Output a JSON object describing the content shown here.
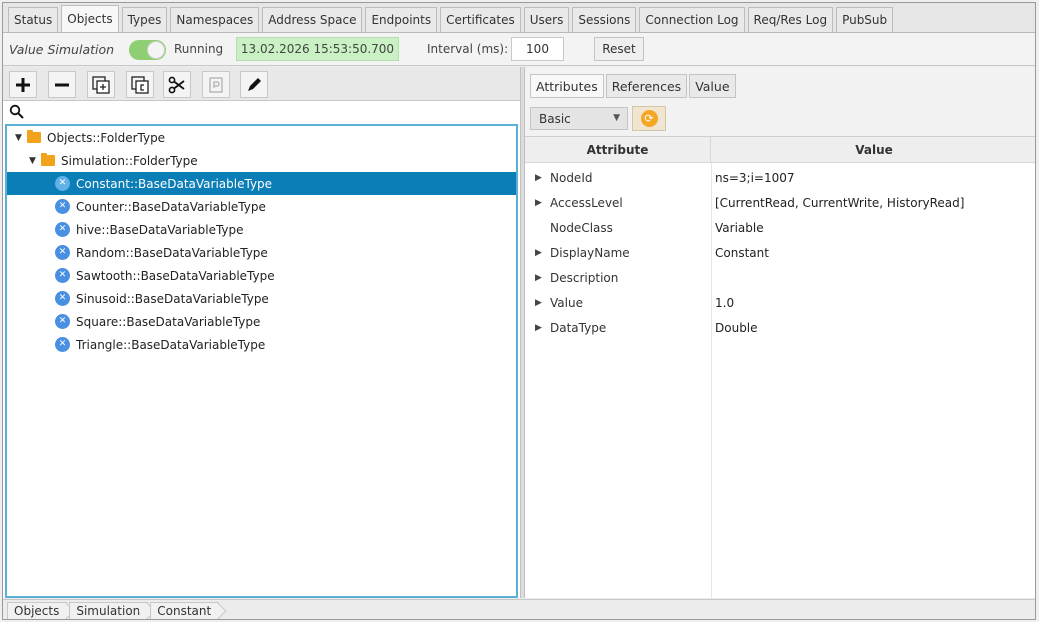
{
  "tabs": [
    "Status",
    "Objects",
    "Types",
    "Namespaces",
    "Address Space",
    "Endpoints",
    "Certificates",
    "Users",
    "Sessions",
    "Connection Log",
    "Req/Res Log",
    "PubSub"
  ],
  "active_tab": "Objects",
  "simulation": {
    "label": "Value Simulation",
    "state": "Running",
    "timestamp": "13.02.2026 15:53:50.700",
    "interval_label": "Interval (ms):",
    "interval_value": "100",
    "reset_label": "Reset",
    "toggle_on": true
  },
  "toolbar": {
    "icons": [
      "add-icon",
      "remove-icon",
      "add-child-icon",
      "copy-icon",
      "cut-icon",
      "paste-icon",
      "edit-icon"
    ]
  },
  "search": {
    "placeholder": ""
  },
  "tree": {
    "root": "Objects::FolderType",
    "folder": "Simulation::FolderType",
    "items": [
      "Constant::BaseDataVariableType",
      "Counter::BaseDataVariableType",
      "hive::BaseDataVariableType",
      "Random::BaseDataVariableType",
      "Sawtooth::BaseDataVariableType",
      "Sinusoid::BaseDataVariableType",
      "Square::BaseDataVariableType",
      "Triangle::BaseDataVariableType"
    ],
    "selected": "Constant::BaseDataVariableType"
  },
  "right": {
    "tabs": [
      "Attributes",
      "References",
      "Value"
    ],
    "active_tab": "Attributes",
    "view": "Basic",
    "headers": {
      "attribute": "Attribute",
      "value": "Value"
    },
    "rows": [
      {
        "name": "NodeId",
        "value": "ns=3;i=1007",
        "expandable": true
      },
      {
        "name": "AccessLevel",
        "value": "[CurrentRead, CurrentWrite, HistoryRead]",
        "expandable": true
      },
      {
        "name": "NodeClass",
        "value": "Variable",
        "expandable": false
      },
      {
        "name": "DisplayName",
        "value": "Constant",
        "expandable": true
      },
      {
        "name": "Description",
        "value": "",
        "expandable": true
      },
      {
        "name": "Value",
        "value": "1.0",
        "expandable": true
      },
      {
        "name": "DataType",
        "value": "Double",
        "expandable": true
      }
    ]
  },
  "breadcrumb": [
    "Objects",
    "Simulation",
    "Constant"
  ],
  "colors": {
    "selection": "#0b7db7",
    "tree_border": "#5ab0d6",
    "timestamp_bg": "#c9f1c3",
    "toggle": "#8fcf73",
    "folder": "#f2a21b"
  }
}
